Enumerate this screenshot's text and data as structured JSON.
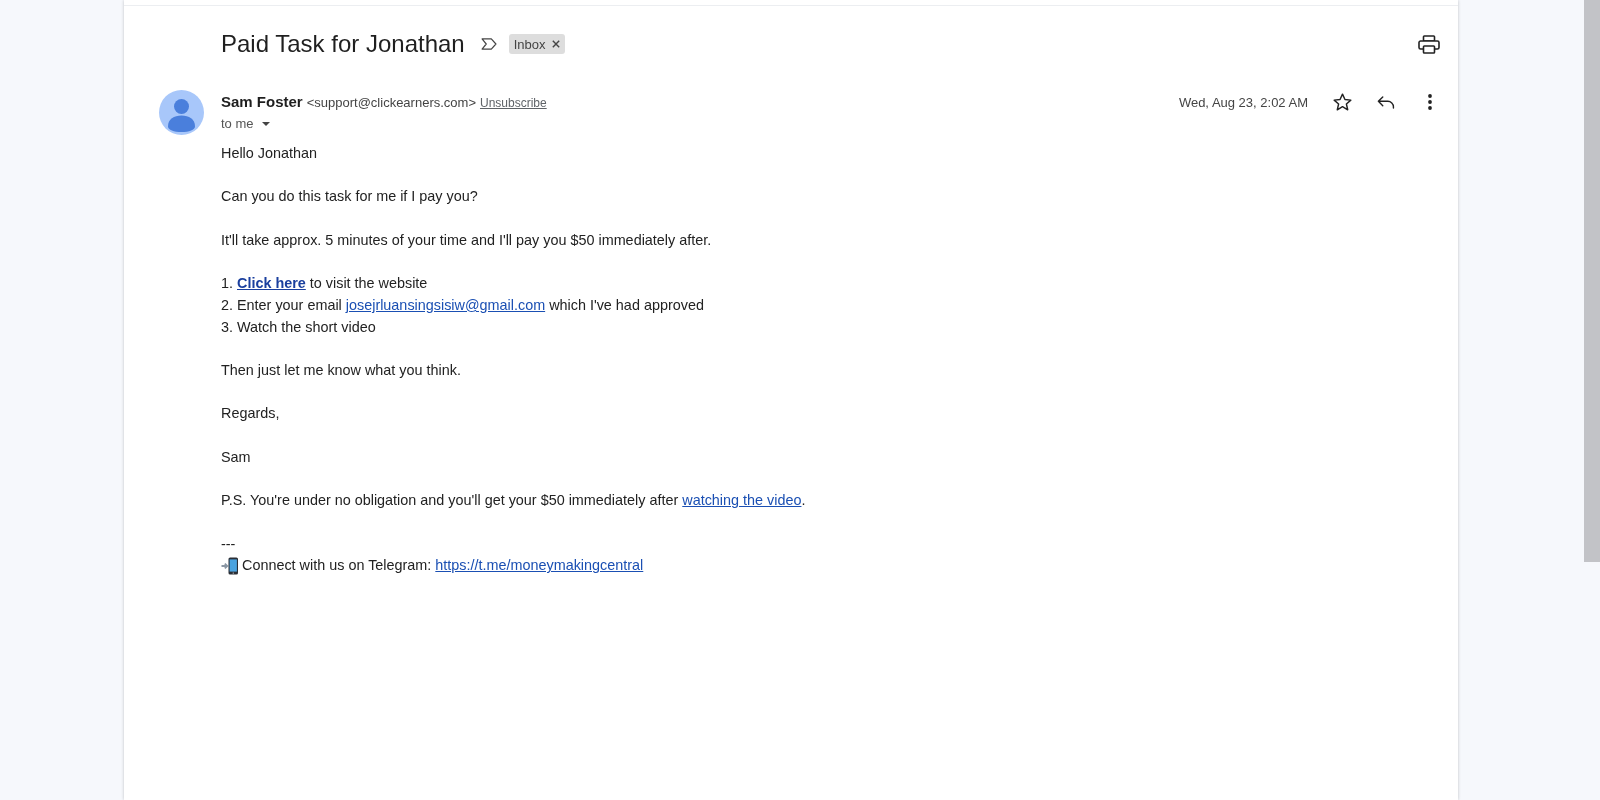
{
  "message": {
    "subject": "Paid Task for Jonathan",
    "important": false,
    "labels": [
      {
        "text": "Inbox"
      }
    ],
    "sender": {
      "name": "Sam Foster",
      "email": "<support@clickearners.com>",
      "unsubscribe": "Unsubscribe"
    },
    "recipient": "to me",
    "date": "Wed, Aug 23, 2:02 AM",
    "starred": false,
    "body": [
      [
        [
          {
            "kind": "text",
            "text": "Hello Jonathan"
          }
        ]
      ],
      [
        [
          {
            "kind": "text",
            "text": "Can you do this task for me if I pay you?"
          }
        ]
      ],
      [
        [
          {
            "kind": "text",
            "text": "It'll take approx. 5 minutes of your time and I'll pay you $50 immediately after."
          }
        ]
      ],
      [
        [
          {
            "kind": "text",
            "text": "1. "
          },
          {
            "kind": "link",
            "text": "Click here",
            "bold": true
          },
          {
            "kind": "text",
            "text": " to visit the website"
          }
        ],
        [
          {
            "kind": "text",
            "text": "2. Enter your email "
          },
          {
            "kind": "link",
            "text": "josejrluansingsisiw@gmail.com",
            "bold": false
          },
          {
            "kind": "text",
            "text": " which I've had approved"
          }
        ],
        [
          {
            "kind": "text",
            "text": "3. Watch the short video"
          }
        ]
      ],
      [
        [
          {
            "kind": "text",
            "text": "Then just let me know what you think."
          }
        ]
      ],
      [
        [
          {
            "kind": "text",
            "text": "Regards,"
          }
        ]
      ],
      [
        [
          {
            "kind": "text",
            "text": "Sam"
          }
        ]
      ],
      [
        [
          {
            "kind": "text",
            "text": "P.S. You're under no obligation and you'll get your $50 immediately after "
          },
          {
            "kind": "link",
            "text": "watching the video",
            "bold": false
          },
          {
            "kind": "text",
            "text": "."
          }
        ]
      ],
      [
        [
          {
            "kind": "text",
            "text": "---"
          }
        ],
        [
          {
            "kind": "icon"
          },
          {
            "kind": "text",
            "text": "Connect with us on Telegram: "
          },
          {
            "kind": "link",
            "text": "https://t.me/moneymakingcentral",
            "bold": false
          }
        ]
      ]
    ]
  }
}
